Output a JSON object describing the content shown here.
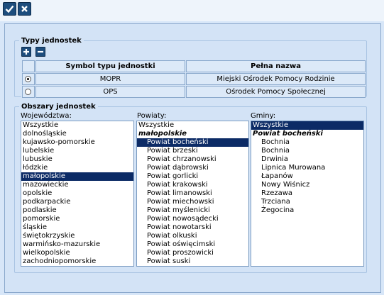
{
  "toolbar": {
    "ok_icon": "check-icon",
    "cancel_icon": "close-icon"
  },
  "typy": {
    "legend": "Typy jednostek",
    "add_icon": "plus-icon",
    "remove_icon": "minus-icon",
    "headers": {
      "symbol": "Symbol typu jednostki",
      "name": "Pełna nazwa"
    },
    "rows": [
      {
        "selected": true,
        "symbol": "MOPR",
        "name": "Miejski Ośrodek Pomocy Rodzinie"
      },
      {
        "selected": false,
        "symbol": "OPS",
        "name": "Ośrodek Pomocy Społecznej"
      }
    ]
  },
  "obszary": {
    "legend": "Obszary jednostek",
    "wojewodztwa": {
      "label": "Województwa:",
      "items": [
        "Wszystkie",
        "dolnośląskie",
        "kujawsko-pomorskie",
        "lubelskie",
        "lubuskie",
        "łódzkie",
        "małopolskie",
        "mazowieckie",
        "opolskie",
        "podkarpackie",
        "podlaskie",
        "pomorskie",
        "śląskie",
        "świętokrzyskie",
        "warmińsko-mazurskie",
        "wielkopolskie",
        "zachodniopomorskie"
      ],
      "selected": "małopolskie"
    },
    "powiaty": {
      "label": "Powiaty:",
      "items": [
        "Wszystkie",
        "małopolskie",
        "Powiat bocheński",
        "Powiat brzeski",
        "Powiat chrzanowski",
        "Powiat dąbrowski",
        "Powiat gorlicki",
        "Powiat krakowski",
        "Powiat limanowski",
        "Powiat miechowski",
        "Powiat myślenicki",
        "Powiat nowosądecki",
        "Powiat nowotarski",
        "Powiat olkuski",
        "Powiat oświęcimski",
        "Powiat proszowicki",
        "Powiat suski"
      ],
      "group": "małopolskie",
      "selected": "Powiat bocheński"
    },
    "gminy": {
      "label": "Gminy:",
      "items": [
        "Wszystkie",
        "Powiat bocheński",
        "Bochnia",
        "Bochnia",
        "Drwinia",
        "Lipnica Murowana",
        "Łapanów",
        "Nowy Wiśnicz",
        "Rzezawa",
        "Trzciana",
        "Żegocina"
      ],
      "group": "Powiat bocheński",
      "selected": "Wszystkie"
    }
  }
}
